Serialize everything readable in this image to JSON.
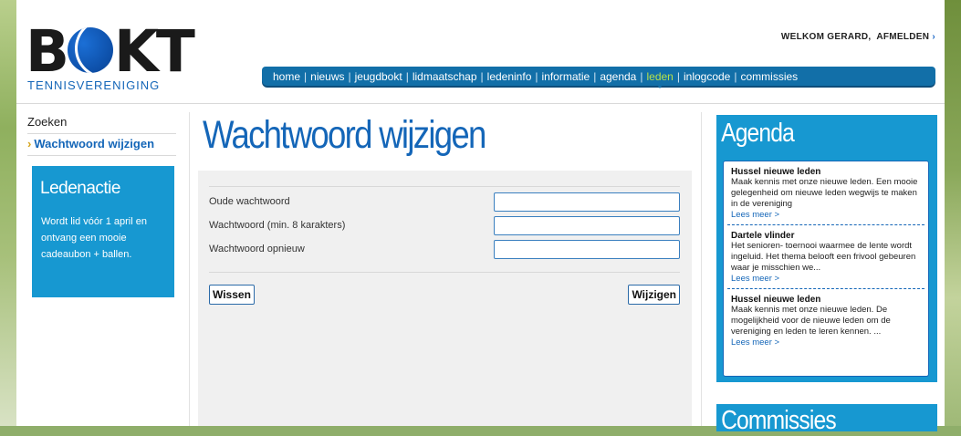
{
  "brand": {
    "logo": "BOKT",
    "logo_b": "B",
    "logo_kt": "KT",
    "subtitle": "TENNISVERENIGING"
  },
  "header": {
    "welcome": "WELKOM GERARD,",
    "logout": "AFMELDEN",
    "arrow": "›"
  },
  "nav": {
    "items": [
      "home",
      "nieuws",
      "jeugdbokt",
      "lidmaatschap",
      "ledeninfo",
      "informatie",
      "agenda",
      "leden",
      "inlogcode",
      "commissies"
    ],
    "active": "leden",
    "separator": "|"
  },
  "sidebar": {
    "items": [
      {
        "label": "Zoeken"
      },
      {
        "label": "Wachtwoord wijzigen",
        "chevron": "›"
      }
    ],
    "promo": {
      "title": "Ledenactie",
      "text": "Wordt lid vóór 1 april en ontvang een mooie cadeaubon + ballen."
    }
  },
  "main": {
    "title": "Wachtwoord wijzigen",
    "fields": [
      {
        "label": "Oude wachtwoord",
        "value": ""
      },
      {
        "label": "Wachtwoord (min. 8 karakters)",
        "value": ""
      },
      {
        "label": "Wachtwoord opnieuw",
        "value": ""
      }
    ],
    "clear_label": "Wissen",
    "submit_label": "Wijzigen"
  },
  "agenda": {
    "title": "Agenda",
    "items": [
      {
        "title": "Hussel nieuwe leden",
        "text": "Maak kennis met onze nieuwe leden. Een mooie gelegenheid om nieuwe leden wegwijs te maken in de vereniging",
        "more": "Lees meer >"
      },
      {
        "title": "Dartele vlinder",
        "text": "Het senioren- toernooi waarmee de lente wordt ingeluid. Het thema belooft een frivool gebeuren waar je misschien we...",
        "more": "Lees meer >"
      },
      {
        "title": "Hussel nieuwe leden",
        "text": "Maak kennis met onze nieuwe leden. De mogelijkheid voor de nieuwe leden om de vereniging en leden te leren kennen. ...",
        "more": "Lees meer >"
      }
    ]
  },
  "commissies": {
    "title": "Commissies"
  },
  "colors": {
    "brand_blue": "#1466b8",
    "nav_blue": "#126fa8",
    "panel_blue": "#1798d1",
    "nav_active": "#b6e04a"
  }
}
